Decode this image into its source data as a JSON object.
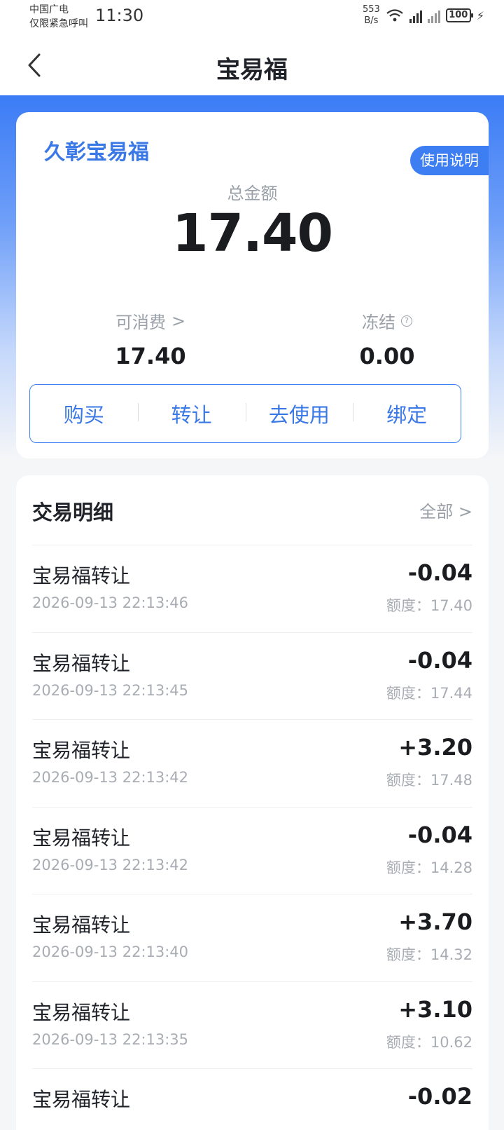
{
  "status_bar": {
    "carrier_line1": "中国广电",
    "carrier_line2": "仅限紧急呼叫",
    "time": "11:30",
    "net_speed_value": "553",
    "net_speed_unit": "B/s",
    "battery": "100"
  },
  "header": {
    "title": "宝易福"
  },
  "balance_card": {
    "title": "久彰宝易福",
    "help_label": "使用说明",
    "total_label": "总金额",
    "total_value": "17.40",
    "available_label": "可消费",
    "available_value": "17.40",
    "frozen_label": "冻结",
    "frozen_value": "0.00",
    "actions": [
      "购买",
      "转让",
      "去使用",
      "绑定"
    ]
  },
  "transactions": {
    "title": "交易明细",
    "all_label": "全部 >",
    "balance_prefix": "额度：",
    "items": [
      {
        "name": "宝易福转让",
        "time": "2026-09-13 22:13:46",
        "amount": "-0.04",
        "balance": "17.40"
      },
      {
        "name": "宝易福转让",
        "time": "2026-09-13 22:13:45",
        "amount": "-0.04",
        "balance": "17.44"
      },
      {
        "name": "宝易福转让",
        "time": "2026-09-13 22:13:42",
        "amount": "+3.20",
        "balance": "17.48"
      },
      {
        "name": "宝易福转让",
        "time": "2026-09-13 22:13:42",
        "amount": "-0.04",
        "balance": "14.28"
      },
      {
        "name": "宝易福转让",
        "time": "2026-09-13 22:13:40",
        "amount": "+3.70",
        "balance": "14.32"
      },
      {
        "name": "宝易福转让",
        "time": "2026-09-13 22:13:35",
        "amount": "+3.10",
        "balance": "10.62"
      },
      {
        "name": "宝易福转让",
        "time": "",
        "amount": "-0.02",
        "balance": ""
      }
    ]
  }
}
